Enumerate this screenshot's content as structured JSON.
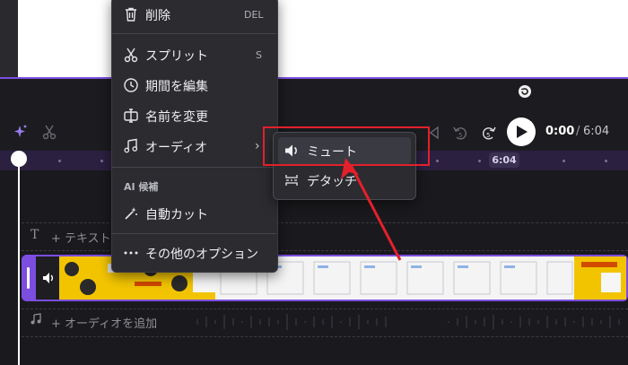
{
  "menu": {
    "items": [
      {
        "label": "削除",
        "shortcut": "DEL",
        "icon": "trash-icon"
      },
      {
        "label": "スプリット",
        "shortcut": "S",
        "icon": "scissors-icon"
      },
      {
        "label": "期間を編集",
        "icon": "clock-icon"
      },
      {
        "label": "名前を変更",
        "icon": "rename-icon"
      },
      {
        "label": "オーディオ",
        "icon": "music-note-icon",
        "has_submenu": true
      }
    ],
    "ai_header": "AI 候補",
    "ai_items": [
      {
        "label": "自動カット",
        "icon": "magic-wand-icon"
      },
      {
        "label": "その他のオプション",
        "icon": "ellipsis-icon"
      }
    ]
  },
  "submenu": {
    "items": [
      {
        "label": "ミュート",
        "icon": "speaker-icon"
      },
      {
        "label": "デタッチ",
        "icon": "detach-icon"
      }
    ]
  },
  "player": {
    "current_time": "0:00",
    "separator": "/",
    "total_time": "6:04"
  },
  "ruler": {
    "marker": "6:04"
  },
  "tracks": {
    "text_add": "+ テキスト",
    "text_glyph": "T",
    "audio_add": "+ オーディオを追加"
  },
  "colors": {
    "accent": "#7b4ee0",
    "highlight_box": "#e3202b",
    "menu_bg": "#2b2b30"
  }
}
